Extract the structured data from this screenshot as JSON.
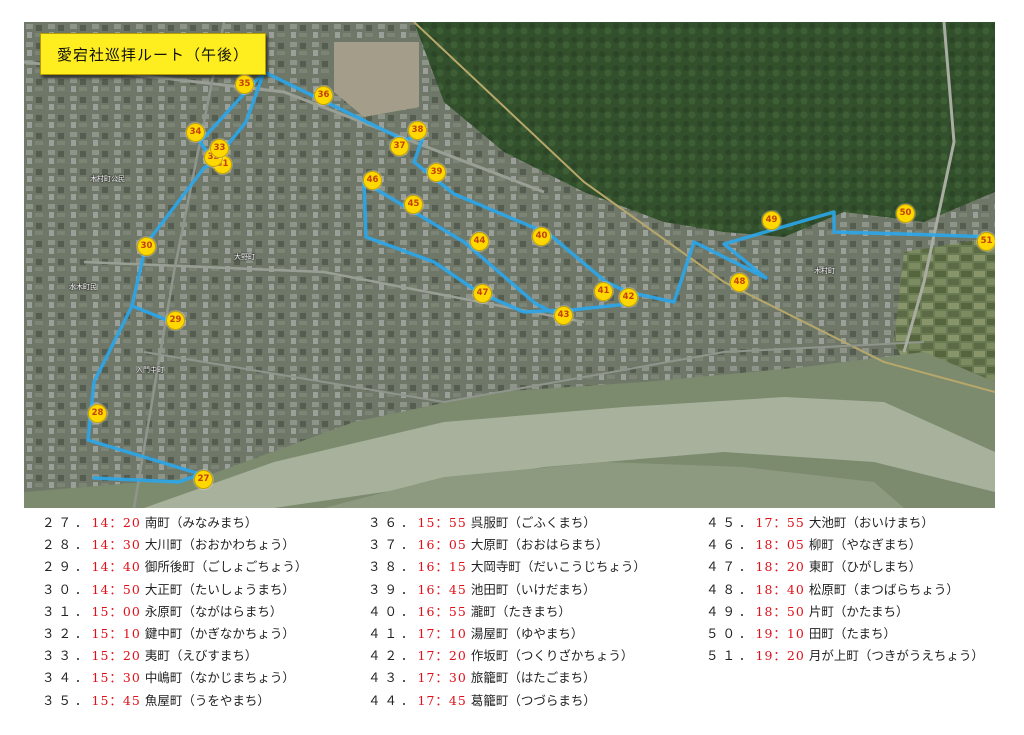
{
  "title": "愛宕社巡拝ルート（午後）",
  "colors": {
    "route": "#2aa6ea",
    "marker_fill": "#ffd800",
    "marker_text": "#c2410c",
    "time": "#e0101a",
    "river": "#9aa78f",
    "title_bg": "#ffee1f"
  },
  "map": {
    "markers": [
      "27",
      "28",
      "29",
      "30",
      "31",
      "32",
      "33",
      "34",
      "35",
      "36",
      "37",
      "38",
      "39",
      "40",
      "41",
      "42",
      "43",
      "44",
      "45",
      "46",
      "47",
      "48",
      "49",
      "50",
      "51"
    ],
    "labels": [
      "木村町公民",
      "水木町民",
      "大野町",
      "入門中町",
      "木村町"
    ]
  },
  "stops": [
    {
      "num": "２７．",
      "time": "14：20",
      "name": "南町（みなみまち）"
    },
    {
      "num": "２８．",
      "time": "14：30",
      "name": "大川町（おおかわちょう）"
    },
    {
      "num": "２９．",
      "time": "14：40",
      "name": "御所後町（ごしょごちょう）"
    },
    {
      "num": "３０．",
      "time": "14：50",
      "name": "大正町（たいしょうまち）"
    },
    {
      "num": "３１．",
      "time": "15：00",
      "name": "永原町（ながはらまち）"
    },
    {
      "num": "３２．",
      "time": "15：10",
      "name": "鍵中町（かぎなかちょう）"
    },
    {
      "num": "３３．",
      "time": "15：20",
      "name": "夷町（えびすまち）"
    },
    {
      "num": "３４．",
      "time": "15：30",
      "name": "中嶋町（なかじまちょう）"
    },
    {
      "num": "３５．",
      "time": "15：45",
      "name": "魚屋町（うをやまち）"
    },
    {
      "num": "３６．",
      "time": "15：55",
      "name": "呉服町（ごふくまち）"
    },
    {
      "num": "３７．",
      "time": "16：05",
      "name": "大原町（おおはらまち）"
    },
    {
      "num": "３８．",
      "time": "16：15",
      "name": "大岡寺町（だいこうじちょう）"
    },
    {
      "num": "３９．",
      "time": "16：45",
      "name": "池田町（いけだまち）"
    },
    {
      "num": "４０．",
      "time": "16：55",
      "name": "瀧町（たきまち）"
    },
    {
      "num": "４１．",
      "time": "17：10",
      "name": "湯屋町（ゆやまち）"
    },
    {
      "num": "４２．",
      "time": "17：20",
      "name": "作坂町（つくりざかちょう）"
    },
    {
      "num": "４３．",
      "time": "17：30",
      "name": "旅籠町（はたごまち）"
    },
    {
      "num": "４４．",
      "time": "17：45",
      "name": "葛籠町（つづらまち）"
    },
    {
      "num": "４５．",
      "time": "17：55",
      "name": "大池町（おいけまち）"
    },
    {
      "num": "４６．",
      "time": "18：05",
      "name": "柳町（やなぎまち）"
    },
    {
      "num": "４７．",
      "time": "18：20",
      "name": "東町（ひがしまち）"
    },
    {
      "num": "４８．",
      "time": "18：40",
      "name": "松原町（まつばらちょう）"
    },
    {
      "num": "４９．",
      "time": "18：50",
      "name": "片町（かたまち）"
    },
    {
      "num": "５０．",
      "time": "19：10",
      "name": "田町（たまち）"
    },
    {
      "num": "５１．",
      "time": "19：20",
      "name": "月が上町（つきがうえちょう）"
    }
  ]
}
